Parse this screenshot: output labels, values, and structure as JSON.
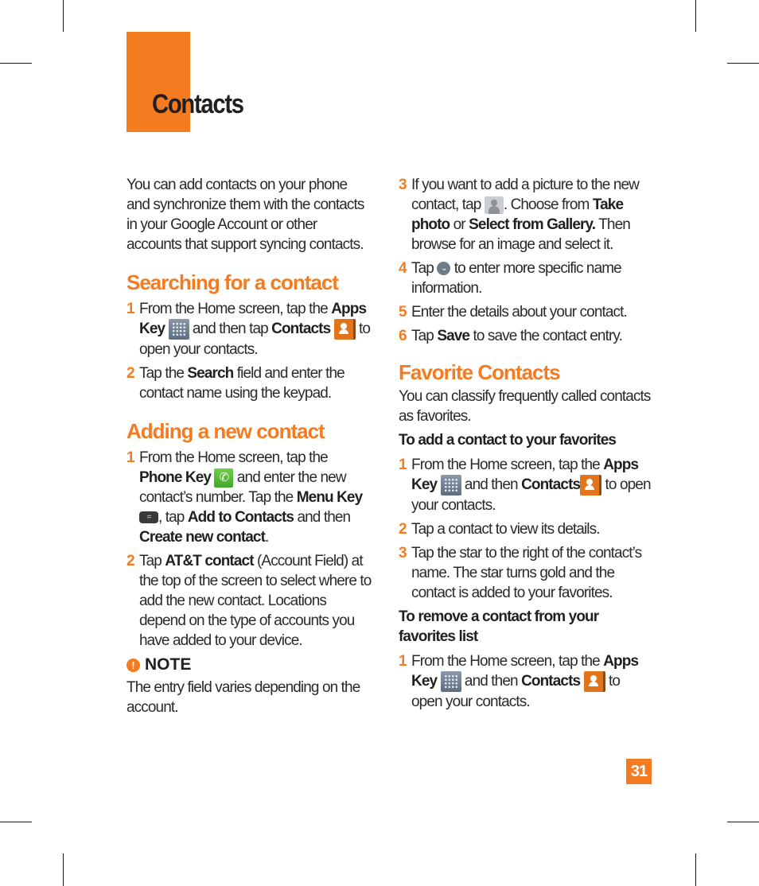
{
  "page": {
    "title": "Contacts",
    "page_number": "31",
    "accent_color": "#f47b20"
  },
  "left": {
    "intro": "You can add contacts on your phone and synchronize them with the contacts in your Google Account or other accounts that support syncing contacts.",
    "search": {
      "heading": "Searching for a contact",
      "steps": [
        {
          "num": "1",
          "t1": "From the Home screen, tap the ",
          "b1": "Apps Key",
          "t2": " and then tap ",
          "b2": "Contacts",
          "t3": " to open your contacts."
        },
        {
          "num": "2",
          "t1": "Tap the ",
          "b1": "Search",
          "t2": " field and enter the contact name using the keypad."
        }
      ]
    },
    "add": {
      "heading": "Adding a new contact",
      "steps": [
        {
          "num": "1",
          "t1": "From the Home screen, tap the ",
          "b1": "Phone Key",
          "t2": " and enter the new contact’s number. Tap the ",
          "b2": "Menu Key",
          "t3": ", tap ",
          "b3": "Add to Contacts",
          "t4": " and then ",
          "b4": "Create new contact",
          "t5": "."
        },
        {
          "num": "2",
          "t1": "Tap ",
          "b1": "AT&T contact",
          "t2": " (Account Field) at the top of the screen to select where to add the new contact. Locations depend on the type of accounts you have added to your device."
        }
      ]
    },
    "note": {
      "label": "NOTE",
      "text": "The entry field varies depending on the account."
    }
  },
  "right": {
    "add_steps": [
      {
        "num": "3",
        "t1": "If you want to add a picture to the new contact, tap ",
        "t2": ". Choose from ",
        "b1": "Take photo",
        "t3": " or ",
        "b2": "Select from Gallery.",
        "t4": " Then browse for an image and select it."
      },
      {
        "num": "4",
        "t1": "Tap ",
        "t2": " to enter more specific name information."
      },
      {
        "num": "5",
        "t1": "Enter the details about your contact."
      },
      {
        "num": "6",
        "t1": "Tap ",
        "b1": "Save",
        "t2": " to save the contact entry."
      }
    ],
    "favorites": {
      "heading": "Favorite Contacts",
      "intro": "You can classify frequently called contacts as favorites.",
      "add_sub": "To add a contact to your favorites",
      "add_steps": [
        {
          "num": "1",
          "t1": "From the Home screen, tap the ",
          "b1": "Apps Key",
          "t2": " and then ",
          "b2": "Contacts",
          "t3": " to open your contacts."
        },
        {
          "num": "2",
          "t1": "Tap a contact to view its details."
        },
        {
          "num": "3",
          "t1": "Tap the star to the right of the contact’s name. The star turns gold and the contact is added to your favorites."
        }
      ],
      "remove_sub": "To remove a contact from your favorites list",
      "remove_steps": [
        {
          "num": "1",
          "t1": "From the Home screen, tap the ",
          "b1": "Apps Key",
          "t2": " and then ",
          "b2": "Contacts",
          "t3": " to open your contacts."
        }
      ]
    }
  }
}
